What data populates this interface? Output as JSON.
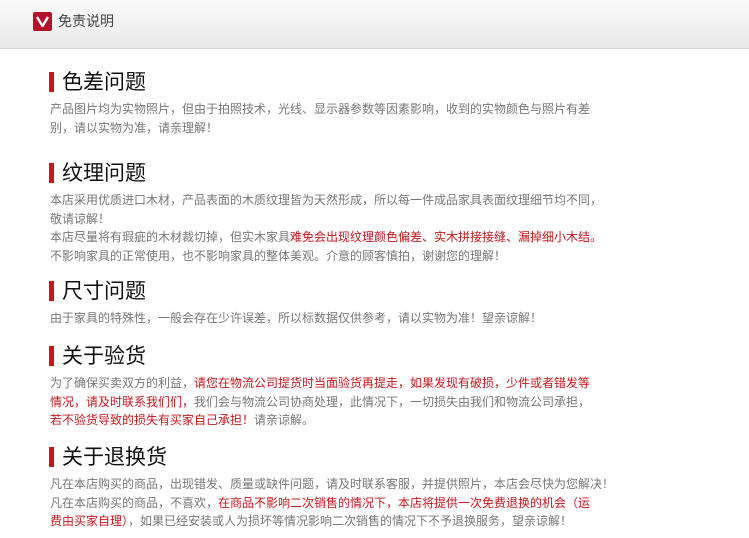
{
  "header": {
    "title": "免责说明",
    "icon": "v-logo-icon"
  },
  "sections": [
    {
      "title": "色差问题",
      "lines": [
        [
          {
            "t": "产品图片均为实物照片，但由于拍照技术，光线、显示器参数等因素影响，收到的实物颜色与照片有差"
          }
        ],
        [
          {
            "t": "别，请以实物为准，请亲理解！"
          }
        ]
      ]
    },
    {
      "title": "纹理问题",
      "lines": [
        [
          {
            "t": "本店采用优质进口木材，产品表面的木质纹理皆为天然形成，所以每一件成品家具表面纹理细节均不同，"
          }
        ],
        [
          {
            "t": "敬请谅解！"
          }
        ],
        [
          {
            "t": "本店尽量将有瑕疵的木材裁切掉，但实木家具"
          },
          {
            "t": "难免会出现纹理颜色偏差、实木拼接接缝、漏掉细小木结。",
            "hl": true
          }
        ],
        [
          {
            "t": "不影响家具的正常使用，也不影响家具的整体美观。介意的顾客慎拍，谢谢您的理解！"
          }
        ]
      ]
    },
    {
      "title": "尺寸问题",
      "lines": [
        [
          {
            "t": "由于家具的特殊性，一般会存在少许误差，所以标数据仅供参考，请以实物为准！望亲谅解！"
          }
        ]
      ]
    },
    {
      "title": "关于验货",
      "lines": [
        [
          {
            "t": "为了确保买卖双方的利益，"
          },
          {
            "t": "请您在物流公司提货时当面验货再提走，如果发现有破损，少件或者错发等",
            "hl": true
          }
        ],
        [
          {
            "t": "情况，请及时联系我们们，",
            "hl": true
          },
          {
            "t": "我们会与物流公司协商处理，此情况下，一切损失由我们和物流公司承担，"
          }
        ],
        [
          {
            "t": "若不验货导致的损失有买家自己承担！",
            "hl": true
          },
          {
            "t": "请亲谅解。"
          }
        ]
      ]
    },
    {
      "title": "关于退换货",
      "lines": [
        [
          {
            "t": "凡在本店购买的商品，出现错发、质量或缺件问题，请及时联系客服，并提供照片，本店会尽快为您解决！"
          }
        ],
        [
          {
            "t": "凡在本店购买的商品，不喜欢，"
          },
          {
            "t": "在商品不影响二次销售的情况下，本店将提供一次免费退换的机会（运",
            "hl": true
          }
        ],
        [
          {
            "t": "费由买家自理）",
            "hl": true
          },
          {
            "t": "，如果已经安装或人为损坏等情况影响二次销售的情况下不予退换服务，望亲谅解！"
          }
        ]
      ]
    }
  ]
}
